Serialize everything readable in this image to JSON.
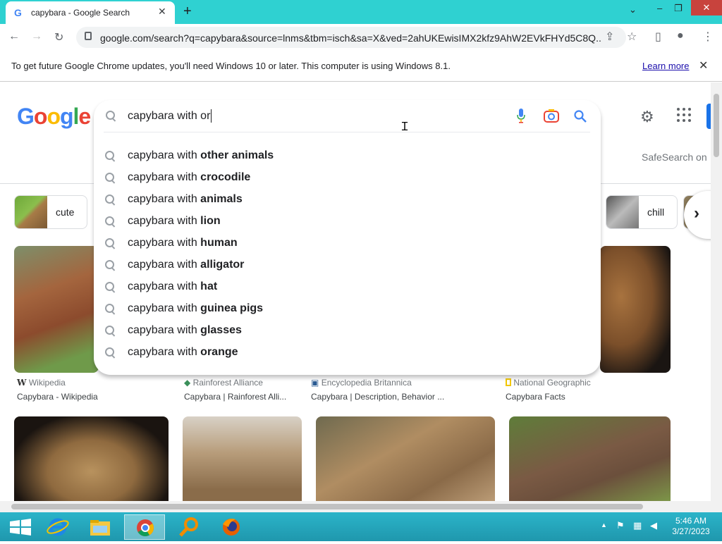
{
  "browser": {
    "tab_title": "capybara - Google Search",
    "tab_favicon": "G",
    "new_tab_glyph": "+",
    "url": "google.com/search?q=capybara&source=lnms&tbm=isch&sa=X&ved=2ahUKEwisIMX2kfz9AhW2EVkFHYd5C8Q...",
    "window_controls": {
      "minimize": "–",
      "restore": "❐",
      "close": "✕",
      "tab_list": "⌄"
    }
  },
  "infobar": {
    "message": "To get future Google Chrome updates, you'll need Windows 10 or later. This computer is using Windows 8.1.",
    "learn_more": "Learn more",
    "close": "✕"
  },
  "google": {
    "logo_letters": [
      "G",
      "o",
      "o",
      "g",
      "l",
      "e"
    ],
    "safesearch": "SafeSearch on",
    "query": "capybara with or",
    "suggestion_prefix": "capybara with ",
    "suggestions": [
      "other animals",
      "crocodile",
      "animals",
      "lion",
      "human",
      "alligator",
      "hat",
      "guinea pigs",
      "glasses",
      "orange"
    ],
    "chips": [
      {
        "label": "cute"
      },
      {
        "label": "chill"
      }
    ],
    "chip_next": "›"
  },
  "results_row1": [
    {
      "source": "Wikipedia",
      "source_icon": "W",
      "caption": "Capybara - Wikipedia"
    },
    {
      "source": "Rainforest Alliance",
      "source_icon": "frog",
      "caption": "Capybara | Rainforest Alli..."
    },
    {
      "source": "Encyclopedia Britannica",
      "source_icon": "britannica",
      "caption": "Capybara | Description, Behavior ..."
    },
    {
      "source": "National Geographic",
      "source_icon": "natgeo",
      "caption": "Capybara Facts"
    }
  ],
  "taskbar": {
    "time": "5:46 AM",
    "date": "3/27/2023",
    "tray_arrow": "▲"
  },
  "colors": {
    "tabstrip": "#2fd1d1",
    "taskbar": "#22a6bb",
    "google_blue": "#4285f4",
    "link": "#1a0dab"
  }
}
